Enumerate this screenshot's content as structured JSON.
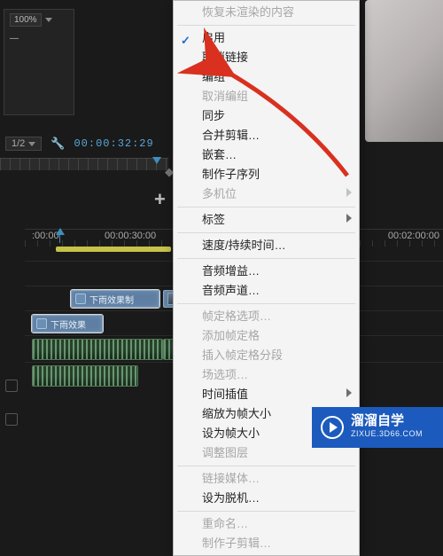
{
  "playback": {
    "ratio": "1/2",
    "timecode": "00:00:32:29"
  },
  "timeline": {
    "ruler": {
      "t0": ":00:00",
      "t1": "00:00:30:00",
      "t2": "00:02:00:00"
    },
    "clip1": "下雨效果制",
    "clip2": "下雨效果"
  },
  "panel": {
    "pct": "100%"
  },
  "menu": {
    "restore": "恢复未渲染的内容",
    "enable": "启用",
    "unlink": "取消链接",
    "group": "编组",
    "ungroup": "取消编组",
    "sync": "同步",
    "merge": "合并剪辑…",
    "nest": "嵌套…",
    "subseq": "制作子序列",
    "multicam": "多机位",
    "label": "标签",
    "speed": "速度/持续时间…",
    "gain": "音频增益…",
    "channels": "音频声道…",
    "holdopts": "帧定格选项…",
    "addhold": "添加帧定格",
    "inserthold": "插入帧定格分段",
    "fieldopts": "场选项…",
    "interp": "时间插值",
    "scalefit": "缩放为帧大小",
    "setfit": "设为帧大小",
    "adj": "调整图层",
    "linkmedia": "链接媒体…",
    "offline": "设为脱机…",
    "rename": "重命名…",
    "makeclip": "制作子剪辑…"
  },
  "watermark": {
    "title": "溜溜自学",
    "sub": "ZIXUE.3D66.COM"
  },
  "icons": {
    "check": "✓",
    "wrench": "🔧",
    "marker": "▾",
    "diamond": "◆",
    "tag": "🔖",
    "plus": "+"
  }
}
